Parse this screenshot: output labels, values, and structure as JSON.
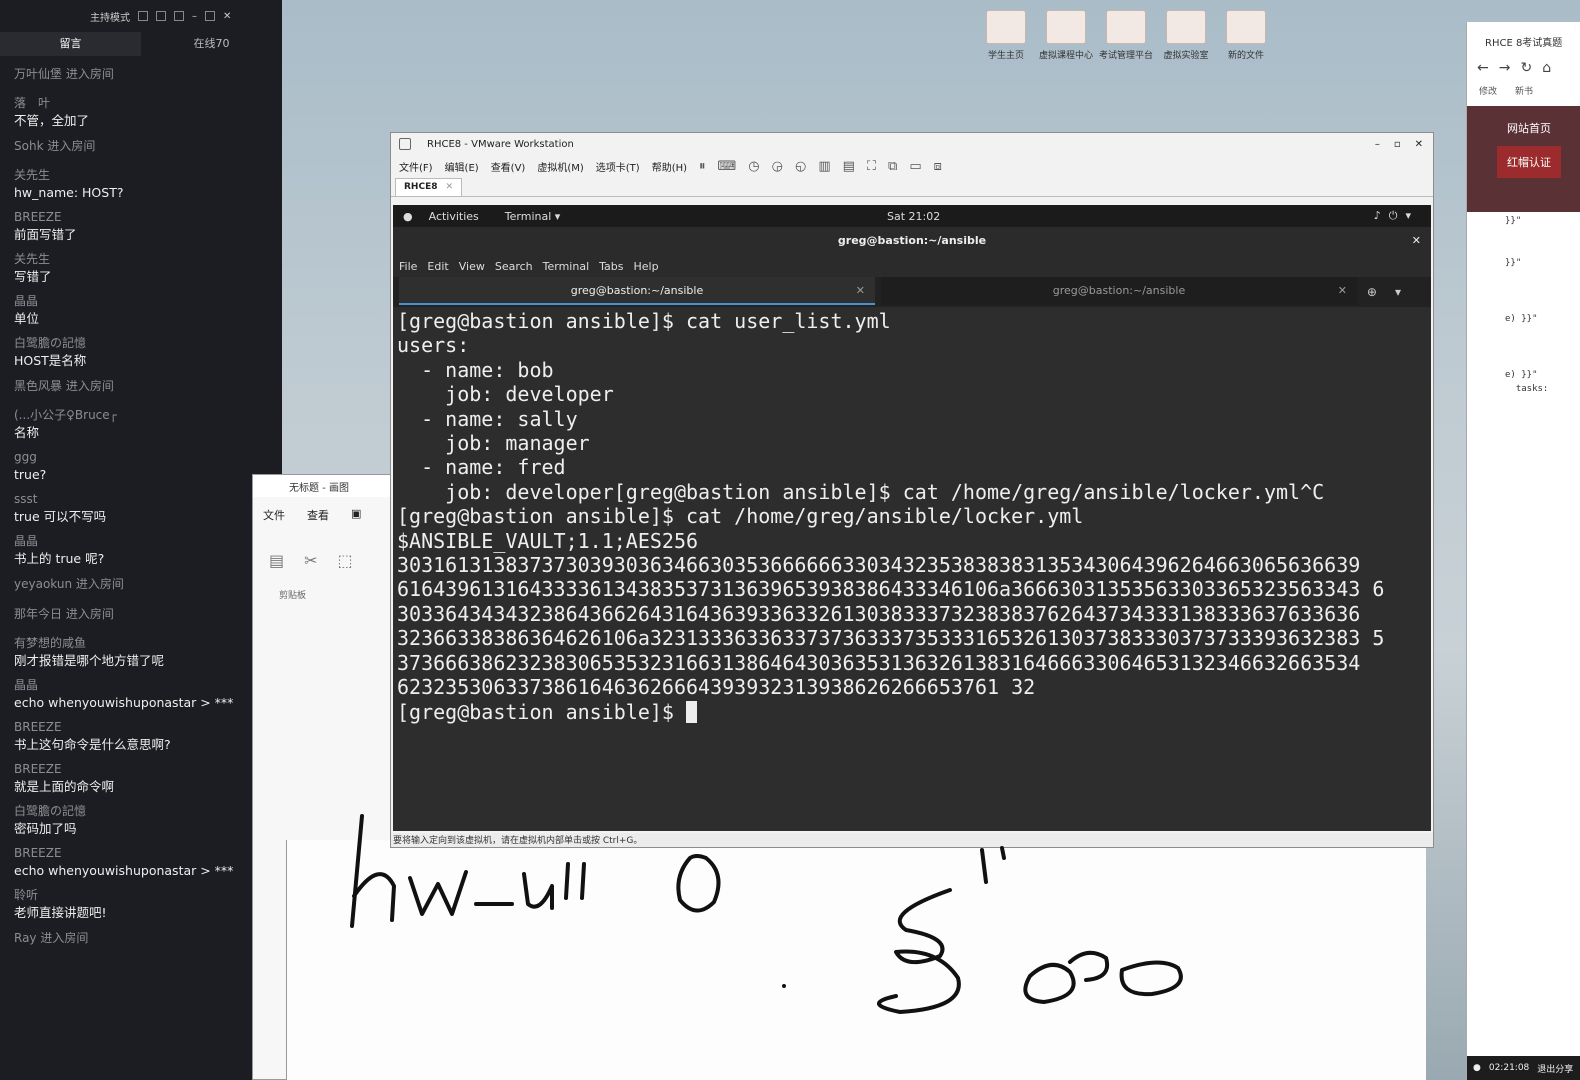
{
  "chat": {
    "header_mode": "主持模式",
    "tabs": [
      "留言",
      "在线70"
    ],
    "messages": [
      {
        "type": "join",
        "text": "万叶仙堡 进入房间"
      },
      {
        "type": "msg",
        "who": "落　叶",
        "text": "不管，全加了"
      },
      {
        "type": "join",
        "text": "Sohk 进入房间"
      },
      {
        "type": "msg",
        "who": "关先生",
        "text": "hw_name: HOST?"
      },
      {
        "type": "msg",
        "who": "BREEZE",
        "text": "前面写错了"
      },
      {
        "type": "msg",
        "who": "关先生",
        "text": "写错了"
      },
      {
        "type": "msg",
        "who": "晶晶",
        "text": "单位"
      },
      {
        "type": "msg",
        "who": "白鹭膽の記憶",
        "text": "HOST是名称"
      },
      {
        "type": "join",
        "text": "黑色风暴 进入房间"
      },
      {
        "type": "msg",
        "who": "(...小公子♀Bruce┌",
        "text": "名称"
      },
      {
        "type": "msg",
        "who": "ggg",
        "text": "true?"
      },
      {
        "type": "msg",
        "who": "ssst",
        "text": "true 可以不写吗"
      },
      {
        "type": "msg",
        "who": "晶晶",
        "text": "书上的 true 呢?"
      },
      {
        "type": "join",
        "text": "yeyaokun 进入房间"
      },
      {
        "type": "join",
        "text": "那年今日 进入房间"
      },
      {
        "type": "msg",
        "who": "有梦想的咸鱼",
        "text": "刚才报错是哪个地方错了呢"
      },
      {
        "type": "msg",
        "who": "晶晶",
        "text": "echo whenyouwishuponastar > ***"
      },
      {
        "type": "msg",
        "who": "BREEZE",
        "text": "书上这句命令是什么意思啊?"
      },
      {
        "type": "msg",
        "who": "BREEZE",
        "text": "就是上面的命令啊"
      },
      {
        "type": "msg",
        "who": "白鹭膽の記憶",
        "text": "密码加了吗"
      },
      {
        "type": "msg",
        "who": "BREEZE",
        "text": "echo whenyouwishuponastar > ***"
      },
      {
        "type": "msg",
        "who": "聆听",
        "text": "老师直接讲题吧!"
      },
      {
        "type": "join",
        "text": "Ray 进入房间"
      }
    ]
  },
  "desktop": {
    "icons": [
      "学生主页",
      "虚拟课程中心",
      "考试管理平台",
      "虚拟实验室",
      "新的文件"
    ]
  },
  "paint": {
    "title": "无标题 - 画图",
    "menu": [
      "文件",
      "查看"
    ],
    "clipboard_label": "剪贴板"
  },
  "browser": {
    "title": "RHCE 8考试真题",
    "links": [
      "修改",
      "新书"
    ],
    "side_items": [
      "网站首页",
      "红帽认证"
    ],
    "code_lines": [
      "}}\"",
      "",
      "",
      "}}\"",
      "",
      "",
      "",
      "e) }}\"",
      "",
      "",
      "",
      "e) }}\"",
      "  tasks:"
    ],
    "footer_time": "02:21:08",
    "footer_action": "退出分享"
  },
  "vmware": {
    "title": "RHCE8 - VMware Workstation",
    "menu": [
      "文件(F)",
      "编辑(E)",
      "查看(V)",
      "虚拟机(M)",
      "选项卡(T)",
      "帮助(H)"
    ],
    "tab": "RHCE8",
    "status": "要将输入定向到该虚拟机，请在虚拟机内部单击或按 Ctrl+G。"
  },
  "gnome": {
    "activities": "Activities",
    "app": "Terminal ▾",
    "clock": "Sat 21:02"
  },
  "terminal": {
    "title": "greg@bastion:~/ansible",
    "menu": [
      "File",
      "Edit",
      "View",
      "Search",
      "Terminal",
      "Tabs",
      "Help"
    ],
    "tabs": [
      "greg@bastion:~/ansible",
      "greg@bastion:~/ansible"
    ],
    "lines": [
      "[greg@bastion ansible]$ cat user_list.yml",
      "users:",
      "  - name: bob",
      "    job: developer",
      "  - name: sally",
      "    job: manager",
      "  - name: fred",
      "    job: developer[greg@bastion ansible]$ cat /home/greg/ansible/locker.yml^C",
      "[greg@bastion ansible]$ cat /home/greg/ansible/locker.yml",
      "$ANSIBLE_VAULT;1.1;AES256",
      "30316131383737303930363466303536666663303432353838383135343064396264663065636639",
      "61643961316433336134383537313639653938386433346106a36663031353563303365323563343 6",
      "30336434343238643662643164363933633261303833373238383762643734333138333637633636",
      "32366338386364626106a32313336336337373633373533316532613037383330373733393632383 5",
      "37366638623238306535323166313864643036353136326138316466633064653132346632663534",
      "62323530633738616463626664393932313938626266653761 32"
    ],
    "prompt": "[greg@bastion ansible]$ "
  }
}
